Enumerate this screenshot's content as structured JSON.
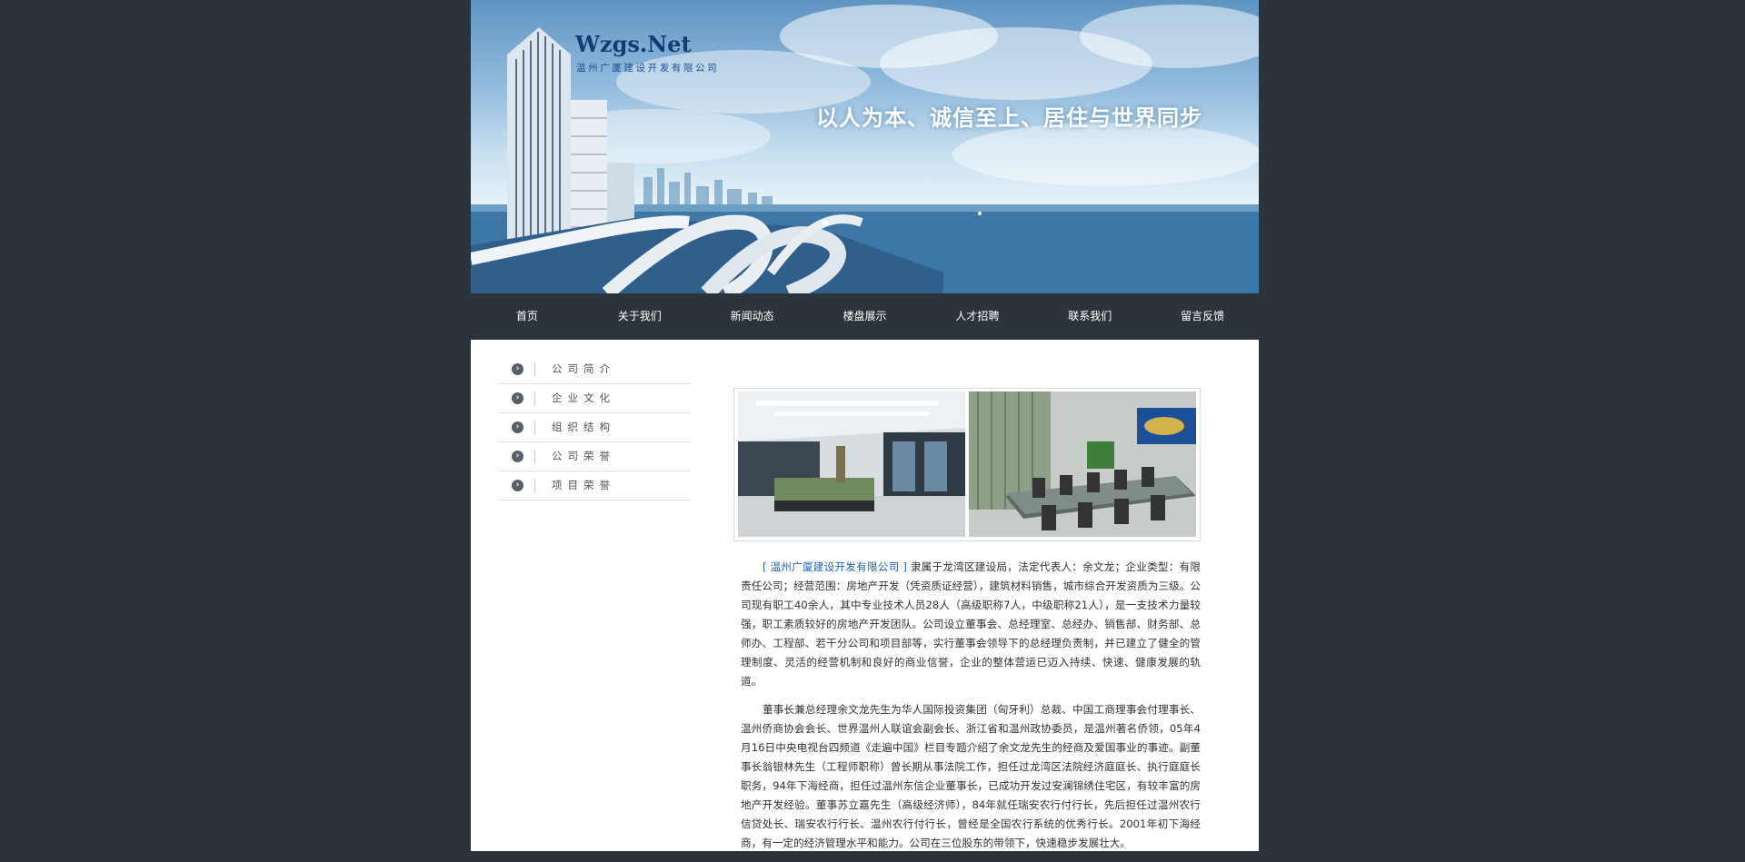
{
  "header": {
    "logo": "Wzgs.Net",
    "company_name": "温州广厦建设开发有限公司",
    "slogan": "以人为本、诚信至上、居住与世界同步"
  },
  "nav": {
    "items": [
      "首页",
      "关于我们",
      "新闻动态",
      "楼盘展示",
      "人才招聘",
      "联系我们",
      "留言反馈"
    ]
  },
  "sidebar": {
    "items": [
      "公司简介",
      "企业文化",
      "组织结构",
      "公司荣誉",
      "项目荣誉"
    ]
  },
  "content": {
    "company_link": "[ 温州广厦建设开发有限公司 ]",
    "para1_rest": "隶属于龙湾区建设局，法定代表人：余文龙；企业类型：有限责任公司；经营范围：房地产开发（凭资质证经营），建筑材料销售，城市综合开发资质为三级。公司现有职工40余人，其中专业技术人员28人（高级职称7人，中级职称21人），是一支技术力量较强，职工素质较好的房地产开发团队。公司设立董事会、总经理室、总经办、销售部、财务部、总师办、工程部、若干分公司和项目部等，实行董事会领导下的总经理负责制，并已建立了健全的管理制度、灵活的经营机制和良好的商业信誉，企业的整体营运已迈入持续、快速、健康发展的轨道。",
    "para2": "董事长兼总经理余文龙先生为华人国际投资集团（匈牙利）总裁、中国工商理事会付理事长、温州侨商协会会长、世界温州人联谊会副会长、浙江省和温州政协委员，是温州著名侨领，05年4月16日中央电视台四频道《走遍中国》栏目专题介绍了余文龙先生的经商及爱国事业的事迹。副董事长翁银林先生（工程师职称）曾长期从事法院工作，担任过龙湾区法院经济庭庭长、执行庭庭长职务，94年下海经商，担任过温州东信企业董事长，已成功开发过安澜锦绣住宅区，有较丰富的房地产开发经验。董事苏立嘉先生（高级经济师），84年就任瑞安农行付行长，先后担任过温州农行信贷处长、瑞安农行行长、温州农行付行长，曾经是全国农行系统的优秀行长。2001年初下海经商，有一定的经济管理水平和能力。公司在三位股东的带领下，快速稳步发展壮大。"
  },
  "colors": {
    "background": "#2b343a",
    "link": "#1f63c4",
    "logo": "#123d73"
  }
}
